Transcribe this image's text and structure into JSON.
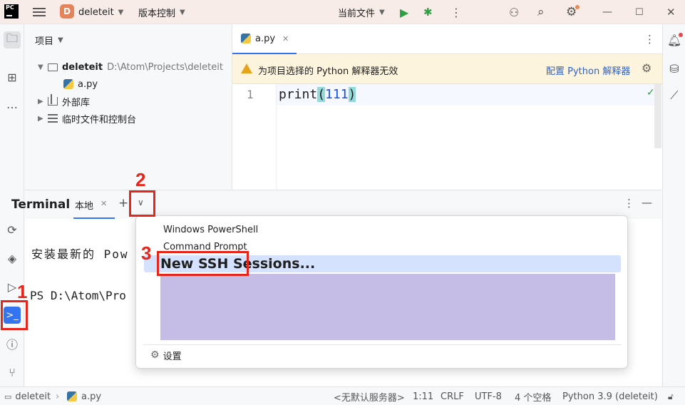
{
  "titlebar": {
    "project_initial": "D",
    "project_name": "deleteit",
    "vcs_label": "版本控制",
    "run_config": "当前文件"
  },
  "project_panel": {
    "header": "项目",
    "root_name": "deleteit",
    "root_path": "D:\\Atom\\Projects\\deleteit",
    "file": "a.py",
    "external_libs": "外部库",
    "scratches": "临时文件和控制台"
  },
  "editor": {
    "tab_name": "a.py",
    "warning_text": "为项目选择的 Python 解释器无效",
    "configure_link": "配置 Python 解释器",
    "line_number": "1",
    "code_func": "print",
    "code_open": "(",
    "code_arg": "111",
    "code_close": ")"
  },
  "terminal": {
    "title": "Terminal",
    "tab_label": "本地",
    "line1": "安装最新的 Pow",
    "line2": "PS D:\\Atom\\Pro"
  },
  "dropdown": {
    "item1": "Windows PowerShell",
    "item2": "Command Prompt",
    "item3": "New SSH Sessions...",
    "settings": "设置"
  },
  "annotations": {
    "n1": "1",
    "n2": "2",
    "n3": "3",
    "color": "#e6251b"
  },
  "statusbar": {
    "project": "deleteit",
    "file": "a.py",
    "server": "<无默认服务器>",
    "position": "1:11",
    "line_sep": "CRLF",
    "encoding": "UTF-8",
    "indent": "4 个空格",
    "interpreter": "Python 3.9 (deleteit)"
  },
  "colors": {
    "accent": "#3574f0",
    "warning_bg": "#fdf4dd",
    "selection": "#d4e2fd",
    "highlight": "#c5bde6"
  }
}
